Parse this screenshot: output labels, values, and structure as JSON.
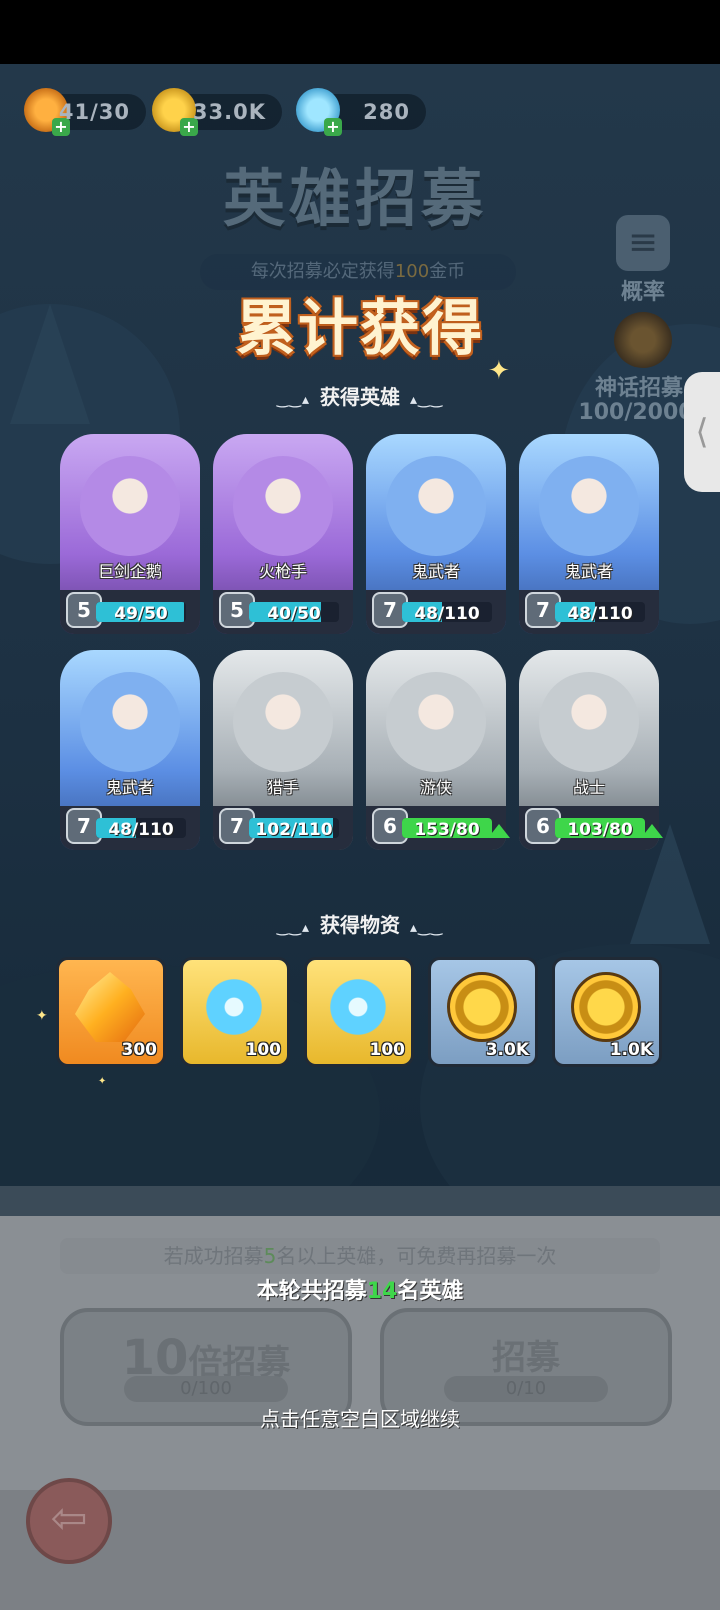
{
  "resources": [
    {
      "icon": "flame-icon",
      "value": "41/30"
    },
    {
      "icon": "gold-coin-icon",
      "value": "33.0K"
    },
    {
      "icon": "blue-crystal-icon",
      "value": "280"
    }
  ],
  "header": {
    "title": "英雄招募",
    "banner_prefix": "每次招募必定获得",
    "banner_highlight": "100",
    "banner_suffix": "金币"
  },
  "side": {
    "probability_label": "概率",
    "myth_label": "神话招募",
    "myth_progress": "100/2000"
  },
  "overlay": {
    "title": "累计获得",
    "heroes_section": "获得英雄",
    "items_section": "获得物资"
  },
  "heroes": [
    {
      "name": "巨剑企鹅",
      "level": "5",
      "progress": "49/50",
      "fraction": 0.98,
      "rarity": "purple",
      "can_upgrade": false
    },
    {
      "name": "火枪手",
      "level": "5",
      "progress": "40/50",
      "fraction": 0.8,
      "rarity": "purple",
      "can_upgrade": false
    },
    {
      "name": "鬼武者",
      "level": "7",
      "progress": "48/110",
      "fraction": 0.436,
      "rarity": "blue",
      "can_upgrade": false
    },
    {
      "name": "鬼武者",
      "level": "7",
      "progress": "48/110",
      "fraction": 0.436,
      "rarity": "blue",
      "can_upgrade": false
    },
    {
      "name": "鬼武者",
      "level": "7",
      "progress": "48/110",
      "fraction": 0.436,
      "rarity": "blue",
      "can_upgrade": false
    },
    {
      "name": "猎手",
      "level": "7",
      "progress": "102/110",
      "fraction": 0.927,
      "rarity": "gray",
      "can_upgrade": false
    },
    {
      "name": "游侠",
      "level": "6",
      "progress": "153/80",
      "fraction": 1,
      "rarity": "gray",
      "can_upgrade": true
    },
    {
      "name": "战士",
      "level": "6",
      "progress": "103/80",
      "fraction": 1,
      "rarity": "gray",
      "can_upgrade": true
    }
  ],
  "items": [
    {
      "icon": "orange-crystal-icon",
      "qty": "300",
      "bg": "orange"
    },
    {
      "icon": "blue-crystal-icon",
      "qty": "100",
      "bg": "yellow"
    },
    {
      "icon": "blue-crystal-icon",
      "qty": "100",
      "bg": "yellow"
    },
    {
      "icon": "gold-coin-icon",
      "qty": "3.0K",
      "bg": "steel"
    },
    {
      "icon": "gold-coin-icon",
      "qty": "1.0K",
      "bg": "steel"
    }
  ],
  "bottom": {
    "hint_prefix": "若成功招募",
    "hint_number": "5",
    "hint_suffix": "名以上英雄，可免费再招募一次",
    "round_prefix": "本轮共招募",
    "round_number": "14",
    "round_suffix": "名英雄",
    "ten_label_num": "10",
    "ten_label": "倍招募",
    "ten_count": "0/100",
    "single_label": "招募",
    "single_count": "0/10",
    "continue_text": "点击任意空白区域继续"
  },
  "colors": {
    "title_orange": "#c4621e",
    "progress_cyan": "#2ec0d6",
    "progress_green": "#3ed64a",
    "purple_card": "#9b6ad8",
    "blue_card": "#5c8fe4",
    "gray_card": "#a8b0b6"
  }
}
